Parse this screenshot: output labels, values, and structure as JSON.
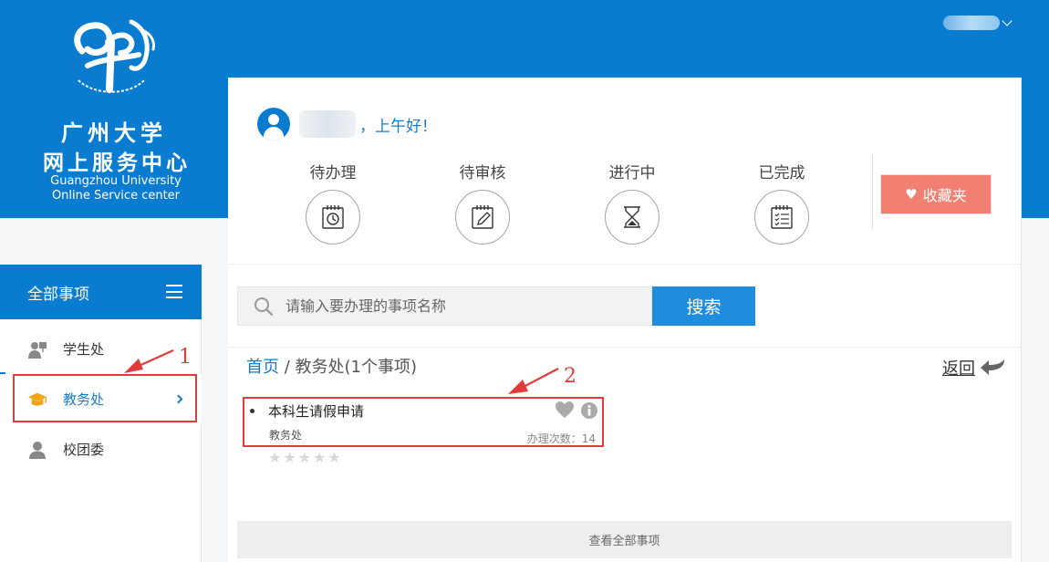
{
  "header": {
    "logo_cn_line1": "广州大学",
    "logo_cn_line2": "网上服务中心",
    "logo_en_line1": "Guangzhou University",
    "logo_en_line2": "Online Service center"
  },
  "greeting": {
    "text": "，上午好！"
  },
  "status": {
    "items": [
      {
        "label": "待办理",
        "icon": "clock-notebook-icon"
      },
      {
        "label": "待审核",
        "icon": "pencil-notebook-icon"
      },
      {
        "label": "进行中",
        "icon": "hourglass-icon"
      },
      {
        "label": "已完成",
        "icon": "checklist-icon"
      }
    ]
  },
  "favorites": {
    "label": "收藏夹",
    "icon": "heart-icon"
  },
  "search": {
    "placeholder": "请输入要办理的事项名称",
    "button_label": "搜索"
  },
  "breadcrumb": {
    "home": "首页",
    "separator": " / ",
    "current": "教务处(1个事项)"
  },
  "back": {
    "label": "返回"
  },
  "item": {
    "title": "本科生请假申请",
    "department": "教务处",
    "count_text": "办理次数：14",
    "rating": 0,
    "rating_max": 5
  },
  "view_all": {
    "label": "查看全部事项"
  },
  "sidebar": {
    "header": "全部事项",
    "items": [
      {
        "label": "学生处",
        "icon": "person-board-icon"
      },
      {
        "label": "教务处",
        "icon": "graduation-cap-icon"
      },
      {
        "label": "校团委",
        "icon": "user-icon"
      }
    ]
  },
  "annotations": {
    "mark1": "1",
    "mark2": "2"
  },
  "colors": {
    "primary": "#0a7ccf",
    "search_button": "#1f8ddc",
    "favorites": "#f18073",
    "annotation": "#e03c3c"
  }
}
